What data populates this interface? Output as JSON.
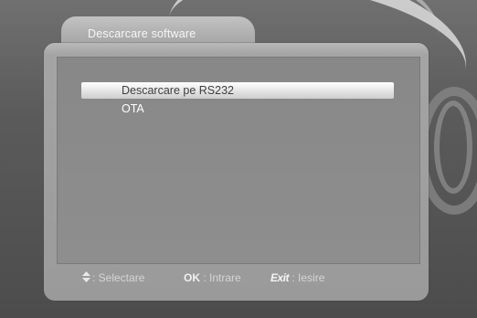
{
  "window": {
    "title": "Descarcare software"
  },
  "menu": {
    "items": [
      {
        "label": "Descarcare pe RS232",
        "selected": true
      },
      {
        "label": "OTA",
        "selected": false
      }
    ]
  },
  "footer": {
    "select": {
      "icon": "up-down-arrows-icon",
      "text": ": Selectare"
    },
    "ok": {
      "key": "OK",
      "text": ": Intrare"
    },
    "exit": {
      "key": "Exit",
      "text": ": Iesire"
    }
  }
}
